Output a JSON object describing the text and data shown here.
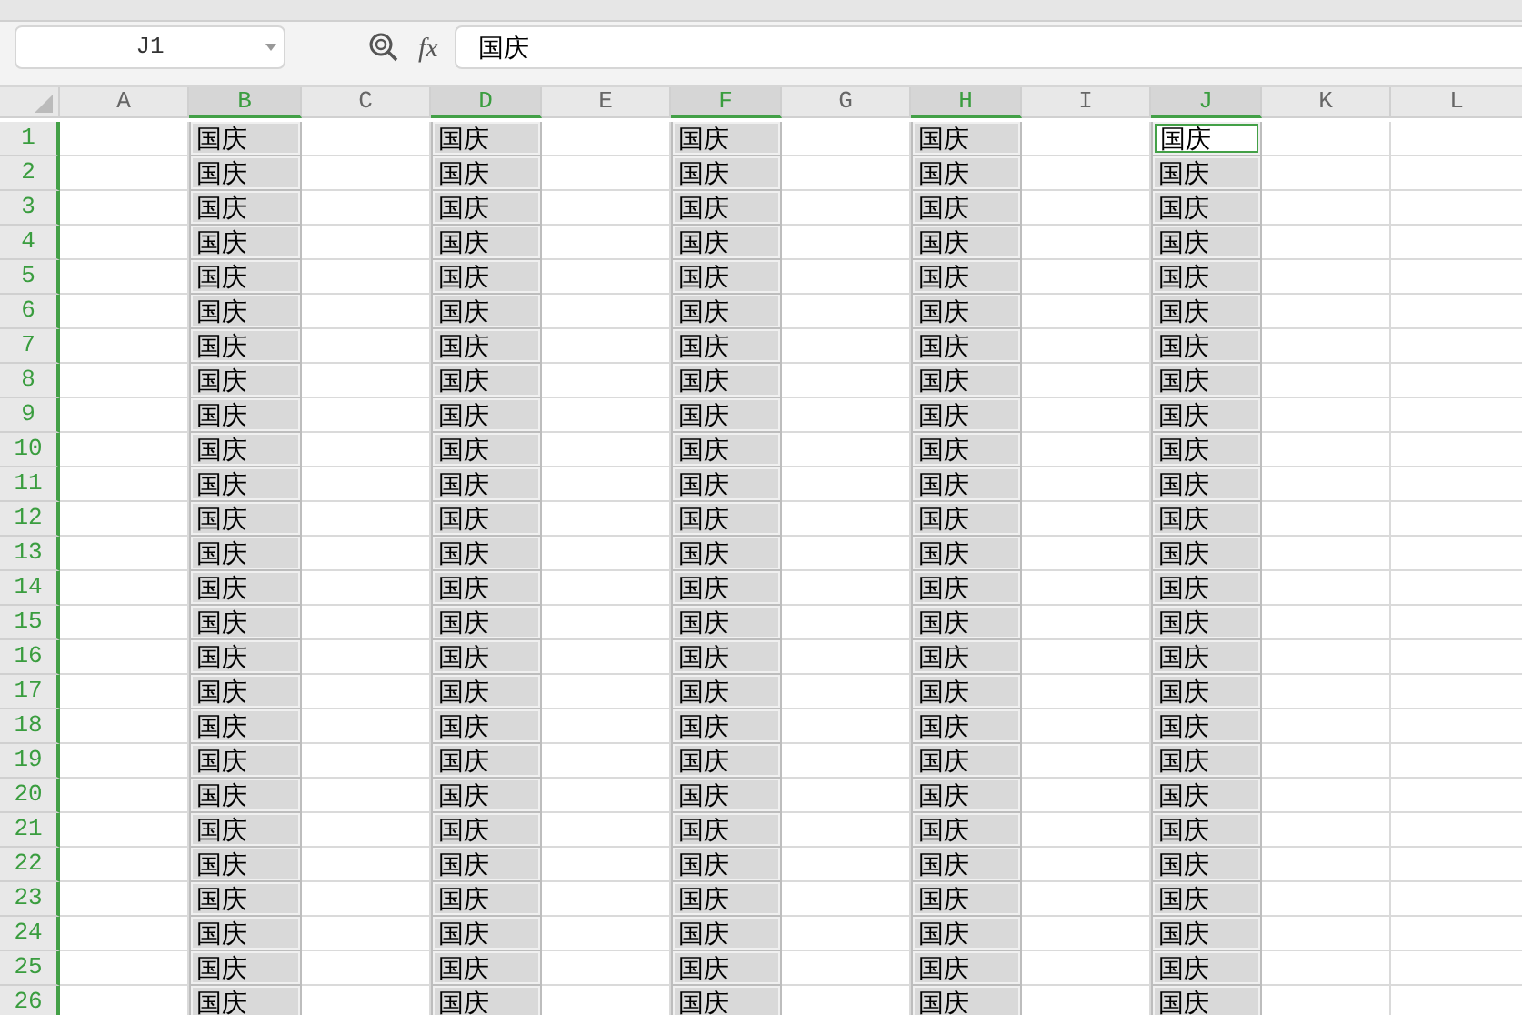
{
  "formula_bar": {
    "name_box": "J1",
    "function_label": "fx",
    "formula": "国庆"
  },
  "columns": [
    {
      "label": "A",
      "selected": false
    },
    {
      "label": "B",
      "selected": true,
      "cells": [
        {
          "text": "国庆",
          "active": false
        },
        {
          "text": "国庆",
          "active": false
        },
        {
          "text": "国庆",
          "active": false
        },
        {
          "text": "国庆",
          "active": false
        },
        {
          "text": "国庆",
          "active": false
        },
        {
          "text": "国庆",
          "active": false
        },
        {
          "text": "国庆",
          "active": false
        },
        {
          "text": "国庆",
          "active": false
        },
        {
          "text": "国庆",
          "active": false
        },
        {
          "text": "国庆",
          "active": false
        },
        {
          "text": "国庆",
          "active": false
        },
        {
          "text": "国庆",
          "active": false
        },
        {
          "text": "国庆",
          "active": false
        },
        {
          "text": "国庆",
          "active": false
        },
        {
          "text": "国庆",
          "active": false
        },
        {
          "text": "国庆",
          "active": false
        },
        {
          "text": "国庆",
          "active": false
        },
        {
          "text": "国庆",
          "active": false
        },
        {
          "text": "国庆",
          "active": false
        },
        {
          "text": "国庆",
          "active": false
        },
        {
          "text": "国庆",
          "active": false
        },
        {
          "text": "国庆",
          "active": false
        },
        {
          "text": "国庆",
          "active": false
        },
        {
          "text": "国庆",
          "active": false
        },
        {
          "text": "国庆",
          "active": false
        },
        {
          "text": "国庆",
          "active": false
        }
      ]
    },
    {
      "label": "C",
      "selected": false
    },
    {
      "label": "D",
      "selected": true,
      "cells": [
        {
          "text": "国庆",
          "active": false
        },
        {
          "text": "国庆",
          "active": false
        },
        {
          "text": "国庆",
          "active": false
        },
        {
          "text": "国庆",
          "active": false
        },
        {
          "text": "国庆",
          "active": false
        },
        {
          "text": "国庆",
          "active": false
        },
        {
          "text": "国庆",
          "active": false
        },
        {
          "text": "国庆",
          "active": false
        },
        {
          "text": "国庆",
          "active": false
        },
        {
          "text": "国庆",
          "active": false
        },
        {
          "text": "国庆",
          "active": false
        },
        {
          "text": "国庆",
          "active": false
        },
        {
          "text": "国庆",
          "active": false
        },
        {
          "text": "国庆",
          "active": false
        },
        {
          "text": "国庆",
          "active": false
        },
        {
          "text": "国庆",
          "active": false
        },
        {
          "text": "国庆",
          "active": false
        },
        {
          "text": "国庆",
          "active": false
        },
        {
          "text": "国庆",
          "active": false
        },
        {
          "text": "国庆",
          "active": false
        },
        {
          "text": "国庆",
          "active": false
        },
        {
          "text": "国庆",
          "active": false
        },
        {
          "text": "国庆",
          "active": false
        },
        {
          "text": "国庆",
          "active": false
        },
        {
          "text": "国庆",
          "active": false
        },
        {
          "text": "国庆",
          "active": false
        }
      ]
    },
    {
      "label": "E",
      "selected": false
    },
    {
      "label": "F",
      "selected": true,
      "cells": [
        {
          "text": "国庆",
          "active": false
        },
        {
          "text": "国庆",
          "active": false
        },
        {
          "text": "国庆",
          "active": false
        },
        {
          "text": "国庆",
          "active": false
        },
        {
          "text": "国庆",
          "active": false
        },
        {
          "text": "国庆",
          "active": false
        },
        {
          "text": "国庆",
          "active": false
        },
        {
          "text": "国庆",
          "active": false
        },
        {
          "text": "国庆",
          "active": false
        },
        {
          "text": "国庆",
          "active": false
        },
        {
          "text": "国庆",
          "active": false
        },
        {
          "text": "国庆",
          "active": false
        },
        {
          "text": "国庆",
          "active": false
        },
        {
          "text": "国庆",
          "active": false
        },
        {
          "text": "国庆",
          "active": false
        },
        {
          "text": "国庆",
          "active": false
        },
        {
          "text": "国庆",
          "active": false
        },
        {
          "text": "国庆",
          "active": false
        },
        {
          "text": "国庆",
          "active": false
        },
        {
          "text": "国庆",
          "active": false
        },
        {
          "text": "国庆",
          "active": false
        },
        {
          "text": "国庆",
          "active": false
        },
        {
          "text": "国庆",
          "active": false
        },
        {
          "text": "国庆",
          "active": false
        },
        {
          "text": "国庆",
          "active": false
        },
        {
          "text": "国庆",
          "active": false
        }
      ]
    },
    {
      "label": "G",
      "selected": false
    },
    {
      "label": "H",
      "selected": true,
      "cells": [
        {
          "text": "国庆",
          "active": false
        },
        {
          "text": "国庆",
          "active": false
        },
        {
          "text": "国庆",
          "active": false
        },
        {
          "text": "国庆",
          "active": false
        },
        {
          "text": "国庆",
          "active": false
        },
        {
          "text": "国庆",
          "active": false
        },
        {
          "text": "国庆",
          "active": false
        },
        {
          "text": "国庆",
          "active": false
        },
        {
          "text": "国庆",
          "active": false
        },
        {
          "text": "国庆",
          "active": false
        },
        {
          "text": "国庆",
          "active": false
        },
        {
          "text": "国庆",
          "active": false
        },
        {
          "text": "国庆",
          "active": false
        },
        {
          "text": "国庆",
          "active": false
        },
        {
          "text": "国庆",
          "active": false
        },
        {
          "text": "国庆",
          "active": false
        },
        {
          "text": "国庆",
          "active": false
        },
        {
          "text": "国庆",
          "active": false
        },
        {
          "text": "国庆",
          "active": false
        },
        {
          "text": "国庆",
          "active": false
        },
        {
          "text": "国庆",
          "active": false
        },
        {
          "text": "国庆",
          "active": false
        },
        {
          "text": "国庆",
          "active": false
        },
        {
          "text": "国庆",
          "active": false
        },
        {
          "text": "国庆",
          "active": false
        },
        {
          "text": "国庆",
          "active": false
        }
      ]
    },
    {
      "label": "I",
      "selected": false
    },
    {
      "label": "J",
      "selected": true,
      "cells": [
        {
          "text": "国庆",
          "active": true
        },
        {
          "text": "国庆",
          "active": false
        },
        {
          "text": "国庆",
          "active": false
        },
        {
          "text": "国庆",
          "active": false
        },
        {
          "text": "国庆",
          "active": false
        },
        {
          "text": "国庆",
          "active": false
        },
        {
          "text": "国庆",
          "active": false
        },
        {
          "text": "国庆",
          "active": false
        },
        {
          "text": "国庆",
          "active": false
        },
        {
          "text": "国庆",
          "active": false
        },
        {
          "text": "国庆",
          "active": false
        },
        {
          "text": "国庆",
          "active": false
        },
        {
          "text": "国庆",
          "active": false
        },
        {
          "text": "国庆",
          "active": false
        },
        {
          "text": "国庆",
          "active": false
        },
        {
          "text": "国庆",
          "active": false
        },
        {
          "text": "国庆",
          "active": false
        },
        {
          "text": "国庆",
          "active": false
        },
        {
          "text": "国庆",
          "active": false
        },
        {
          "text": "国庆",
          "active": false
        },
        {
          "text": "国庆",
          "active": false
        },
        {
          "text": "国庆",
          "active": false
        },
        {
          "text": "国庆",
          "active": false
        },
        {
          "text": "国庆",
          "active": false
        },
        {
          "text": "国庆",
          "active": false
        },
        {
          "text": "国庆",
          "active": false
        }
      ]
    },
    {
      "label": "K",
      "selected": false
    },
    {
      "label": "L",
      "selected": false
    }
  ],
  "rows": [
    {
      "label": "1",
      "selected": true
    },
    {
      "label": "2",
      "selected": true
    },
    {
      "label": "3",
      "selected": true
    },
    {
      "label": "4",
      "selected": true
    },
    {
      "label": "5",
      "selected": true
    },
    {
      "label": "6",
      "selected": true
    },
    {
      "label": "7",
      "selected": true
    },
    {
      "label": "8",
      "selected": true
    },
    {
      "label": "9",
      "selected": true
    },
    {
      "label": "10",
      "selected": true
    },
    {
      "label": "11",
      "selected": true
    },
    {
      "label": "12",
      "selected": true
    },
    {
      "label": "13",
      "selected": true
    },
    {
      "label": "14",
      "selected": true
    },
    {
      "label": "15",
      "selected": true
    },
    {
      "label": "16",
      "selected": true
    },
    {
      "label": "17",
      "selected": true
    },
    {
      "label": "18",
      "selected": true
    },
    {
      "label": "19",
      "selected": true
    },
    {
      "label": "20",
      "selected": true
    },
    {
      "label": "21",
      "selected": true
    },
    {
      "label": "22",
      "selected": true
    },
    {
      "label": "23",
      "selected": true
    },
    {
      "label": "24",
      "selected": true
    },
    {
      "label": "25",
      "selected": true
    },
    {
      "label": "26",
      "selected": true
    }
  ]
}
